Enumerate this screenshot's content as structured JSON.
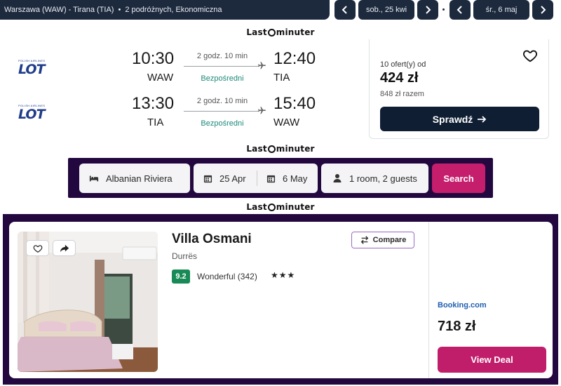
{
  "flight_search": {
    "route_summary": "Warszawa (WAW) - Tirana (TIA)",
    "separator": "•",
    "passengers_class": "2 podróżnych, Ekonomiczna",
    "depart_date": "sob., 25 kwi",
    "return_date": "śr., 6 maj"
  },
  "brand": {
    "prefix": "Last",
    "suffix": "minuter"
  },
  "flight_result": {
    "legs": [
      {
        "airline_small": "POLISH AIRLINES",
        "airline_logo": "LOT",
        "dep_time": "10:30",
        "dep_code": "WAW",
        "duration": "2 godz. 10 min",
        "stops": "Bezpośredni",
        "arr_time": "12:40",
        "arr_code": "TIA"
      },
      {
        "airline_small": "POLISH AIRLINES",
        "airline_logo": "LOT",
        "dep_time": "13:30",
        "dep_code": "TIA",
        "duration": "2 godz. 10 min",
        "stops": "Bezpośredni",
        "arr_time": "15:40",
        "arr_code": "WAW"
      }
    ],
    "offers": "10 ofert(y) od",
    "price": "424 zł",
    "total": "848 zł razem",
    "check_label": "Sprawdź"
  },
  "hotel_search": {
    "destination": "Albanian Riviera",
    "checkin": "25 Apr",
    "checkout": "6 May",
    "guests": "1 room, 2 guests",
    "search_label": "Search"
  },
  "hotel_result": {
    "name": "Villa Osmani",
    "city": "Durrës",
    "rating": "9.2",
    "rating_text": "Wonderful (342)",
    "stars": "★★★",
    "compare_label": "Compare",
    "provider": "Booking.com",
    "price": "718 zł",
    "deal_label": "View Deal"
  },
  "colors": {
    "navy": "#1d2a3d",
    "button_dark": "#0f1e33",
    "lot_blue": "#1f3c88",
    "teal_stops": "#1d8a7a",
    "purple_bg": "#23083f",
    "magenta": "#c41e6d",
    "rating_green": "#188a56"
  }
}
